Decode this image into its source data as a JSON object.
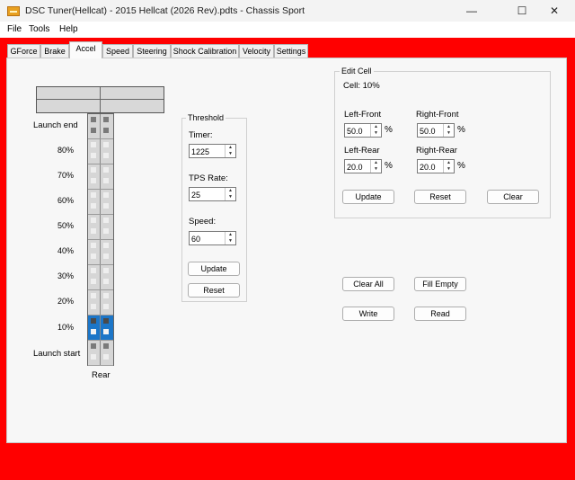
{
  "window": {
    "title": "DSC Tuner(Hellcat) - 2015 Hellcat (2026 Rev).pdts - Chassis Sport",
    "icon": "app-icon",
    "controls": {
      "minimize": "—",
      "maximize": "☐",
      "close": "✕"
    }
  },
  "menu": [
    "File",
    "Tools",
    "Help"
  ],
  "tabs": [
    "GForce",
    "Brake",
    "Accel",
    "Speed",
    "Steering",
    "Shock Calibration",
    "Velocity",
    "Settings"
  ],
  "active_tab": "Accel",
  "accel_map": {
    "label_end": "Launch end",
    "label_start": "Launch start",
    "label_rear": "Rear",
    "percent_labels": [
      "80%",
      "70%",
      "60%",
      "50%",
      "40%",
      "30%",
      "20%",
      "10%"
    ],
    "selected_row": "10%",
    "rows": [
      {
        "name": "launch-end",
        "cells": [
          "on",
          "on",
          "on",
          "on"
        ]
      },
      {
        "name": "80",
        "cells": [
          "off",
          "off",
          "off",
          "off"
        ]
      },
      {
        "name": "70",
        "cells": [
          "off",
          "off",
          "off",
          "off"
        ]
      },
      {
        "name": "60",
        "cells": [
          "off",
          "off",
          "off",
          "off"
        ]
      },
      {
        "name": "50",
        "cells": [
          "off",
          "off",
          "off",
          "off"
        ]
      },
      {
        "name": "40",
        "cells": [
          "off",
          "off",
          "off",
          "off"
        ]
      },
      {
        "name": "30",
        "cells": [
          "off",
          "off",
          "off",
          "off"
        ]
      },
      {
        "name": "20",
        "cells": [
          "off",
          "off",
          "off",
          "off"
        ]
      },
      {
        "name": "10",
        "cells": [
          "on",
          "on",
          "off",
          "off"
        ]
      },
      {
        "name": "launch-start",
        "cells": [
          "on",
          "on",
          "off",
          "off"
        ]
      }
    ]
  },
  "threshold": {
    "title": "Threshold",
    "timer_label": "Timer:",
    "timer_value": "1225",
    "tps_label": "TPS Rate:",
    "tps_value": "25",
    "speed_label": "Speed:",
    "speed_value": "60",
    "update_label": "Update",
    "reset_label": "Reset"
  },
  "edit_cell": {
    "title": "Edit Cell",
    "cell_label": "Cell: 10%",
    "left_front_label": "Left-Front",
    "left_front_value": "50.0",
    "right_front_label": "Right-Front",
    "right_front_value": "50.0",
    "left_rear_label": "Left-Rear",
    "left_rear_value": "20.0",
    "right_rear_label": "Right-Rear",
    "right_rear_value": "20.0",
    "percent": "%",
    "update_label": "Update",
    "reset_label": "Reset",
    "clear_label": "Clear"
  },
  "actions": {
    "clear_all": "Clear All",
    "fill_empty": "Fill Empty",
    "write": "Write",
    "read": "Read"
  },
  "colors": {
    "frame": "#ff0000",
    "selection": "#1c76c8",
    "app_icon": "#e8a020"
  }
}
